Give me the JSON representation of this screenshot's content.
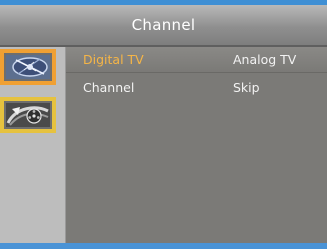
{
  "window": {
    "title": "Channel"
  },
  "sidebar": {
    "items": [
      {
        "icon": "satellite-dish-icon",
        "selected": true
      },
      {
        "icon": "film-reel-icon",
        "selected": false
      }
    ]
  },
  "menu": {
    "rows": [
      {
        "label": "Digital TV",
        "value": "Analog TV",
        "highlighted": true
      },
      {
        "label": "Channel",
        "value": "Skip",
        "highlighted": false
      }
    ]
  },
  "colors": {
    "accent": "#f5b547",
    "selected_tile_border": "#f0a033",
    "tile_border": "#e6c23f",
    "frame_edge": "#3f8fd4",
    "panel": "#7b7a77"
  }
}
